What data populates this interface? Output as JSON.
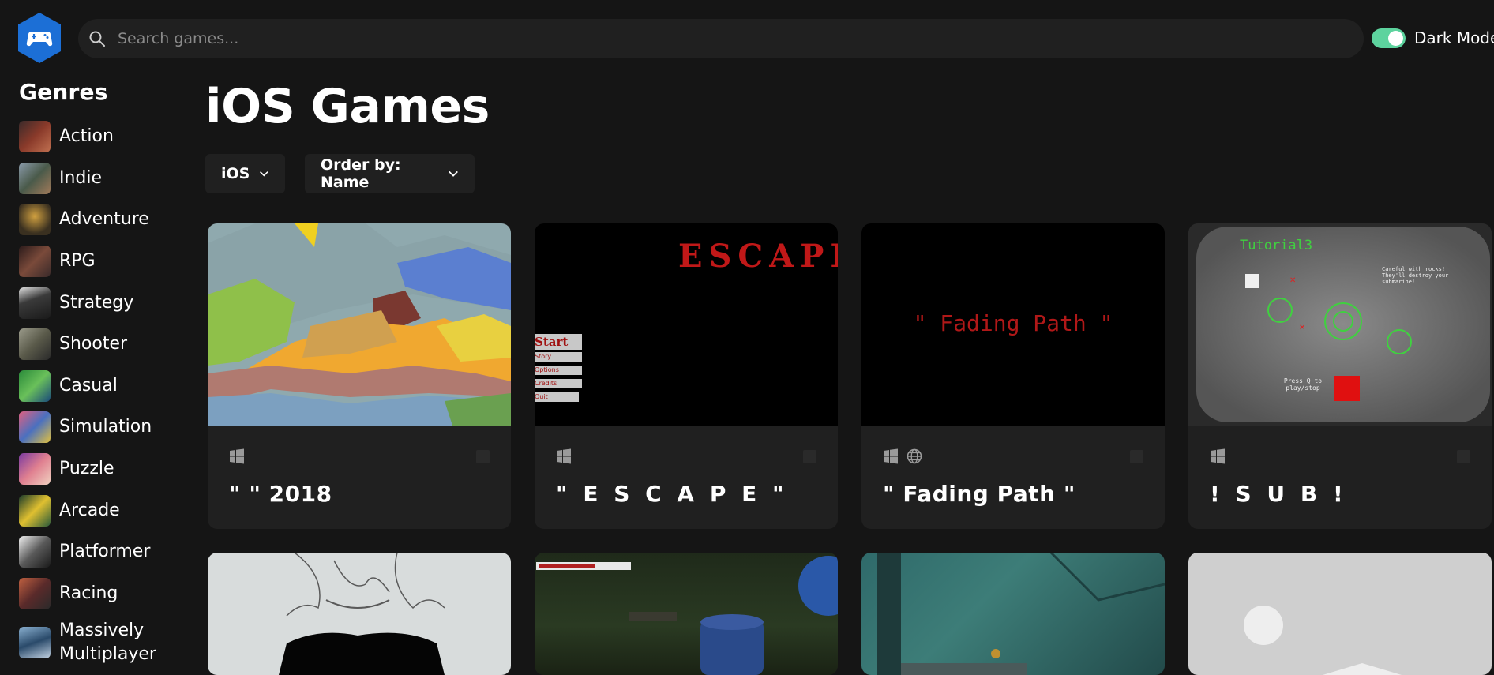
{
  "search": {
    "placeholder": "Search games..."
  },
  "theme_toggle": {
    "label": "Dark Mode",
    "on": true,
    "color": "#5dd39e"
  },
  "sidebar": {
    "title": "Genres",
    "items": [
      {
        "label": "Action",
        "color": "#8a3a2a"
      },
      {
        "label": "Indie",
        "color": "#5a6a7a"
      },
      {
        "label": "Adventure",
        "color": "#6a5a2a"
      },
      {
        "label": "RPG",
        "color": "#5a3a3a"
      },
      {
        "label": "Strategy",
        "color": "#3a3a3a"
      },
      {
        "label": "Shooter",
        "color": "#6a6a5a"
      },
      {
        "label": "Casual",
        "color": "#3a7a3a"
      },
      {
        "label": "Simulation",
        "color": "#b04060"
      },
      {
        "label": "Puzzle",
        "color": "#c05070"
      },
      {
        "label": "Arcade",
        "color": "#c0a030"
      },
      {
        "label": "Platformer",
        "color": "#7a7a7a"
      },
      {
        "label": "Racing",
        "color": "#7a3a2a"
      },
      {
        "label": "Massively Multiplayer",
        "color": "#4a6a8a"
      }
    ]
  },
  "main": {
    "title": "iOS Games",
    "platform_dropdown": "iOS",
    "order_dropdown": "Order by: Name"
  },
  "games": [
    {
      "title": "\" \" 2018",
      "platforms": [
        "windows-icon"
      ]
    },
    {
      "title": "\" E S C A P E \"",
      "platforms": [
        "windows-icon"
      ],
      "screenshot_text": "ESCAPE",
      "menu": [
        "Start",
        "Story",
        "Options",
        "Credits",
        "Quit"
      ]
    },
    {
      "title": "\" Fading Path \"",
      "platforms": [
        "windows-icon",
        "globe-icon"
      ],
      "screenshot_text": "\" Fading Path \""
    },
    {
      "title": "! S U B !",
      "platforms": [
        "windows-icon"
      ],
      "screenshot_text": "Tutorial3",
      "screenshot_note": "Careful with rocks! They'll destroy your submarine!",
      "screenshot_hint": "Press Q to play/stop"
    }
  ],
  "colors": {
    "background": "#151515",
    "card": "#202020",
    "accent": "#5dd39e",
    "logo": "#1c6fd6"
  }
}
